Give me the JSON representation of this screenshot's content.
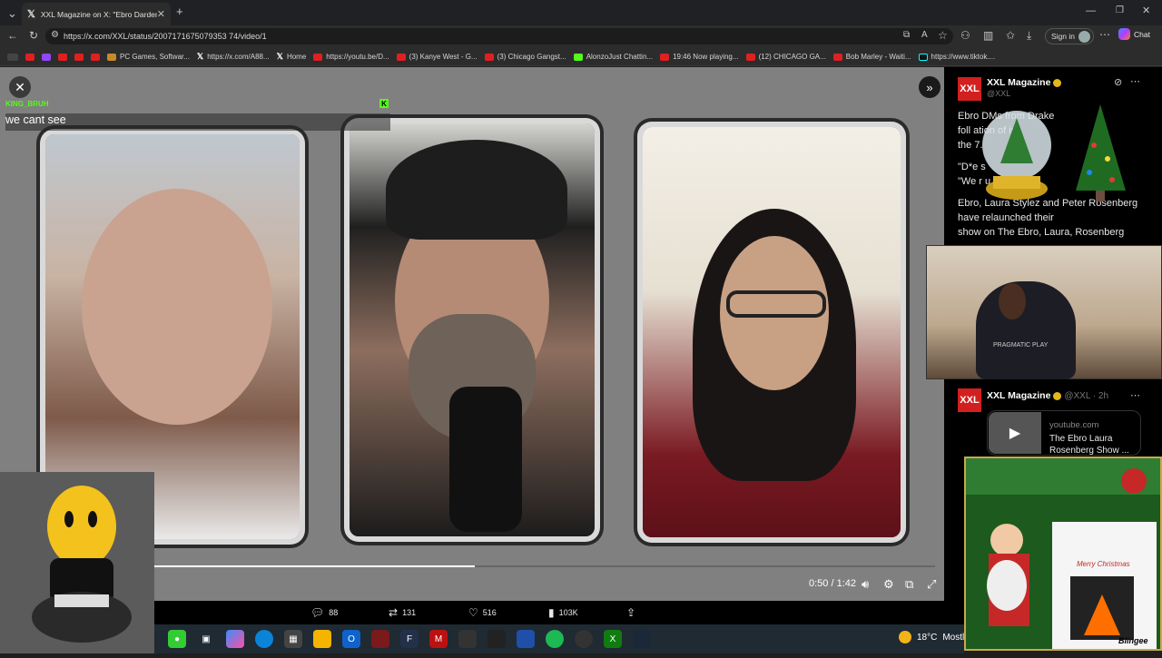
{
  "browser": {
    "tab_title": "XXL Magazine on X: \"Ebro Darden",
    "url": "https://x.com/XXL/status/2007171675079353 74/video/1",
    "sign_in": "Sign in",
    "chat": "Chat"
  },
  "bookmarks": [
    {
      "label": "PC Games, Softwar...",
      "icon": "pc-icon"
    },
    {
      "label": "https://x.com/A88...",
      "icon": "x-icon"
    },
    {
      "label": "Home",
      "icon": "x-icon"
    },
    {
      "label": "https://youtu.be/D...",
      "icon": "youtube-icon"
    },
    {
      "label": "(3) Kanye West - G...",
      "icon": "youtube-icon"
    },
    {
      "label": "(3) Chicago Gangst...",
      "icon": "youtube-icon"
    },
    {
      "label": "AlonzoJust Chattin...",
      "icon": "kick-icon"
    },
    {
      "label": "19:46 Now playing...",
      "icon": "youtube-icon"
    },
    {
      "label": "(12) CHICAGO GA...",
      "icon": "youtube-icon"
    },
    {
      "label": "Bob Marley - Waiti...",
      "icon": "youtube-icon"
    },
    {
      "label": "https://www.tiktok....",
      "icon": "tiktok-icon"
    }
  ],
  "chat_overlay": {
    "username": "KING_BRUH",
    "message": "we cant see"
  },
  "video": {
    "time": "0:50 / 1:42",
    "progress": 0.41
  },
  "actions": {
    "replies": "88",
    "reposts": "131",
    "likes": "516",
    "views": "103K"
  },
  "sidebar": {
    "account_name": "XXL Magazine",
    "handle": "@XXL",
    "logo": "XXL",
    "tweet_line1": "Ebro                DMs from Drake",
    "tweet_line2": "foll               ation of  in",
    "tweet_line3": "the                 7.",
    "tweet_line4": "\"D*e s",
    "tweet_line5": "\"We                     r u",
    "tweet_line6": "Ebro, Laura Stylez and Peter Rosenberg have relaunched their",
    "tweet_line7": "show on The Ebro, Laura, Rosenberg",
    "tweet2_name": "XXL Magazine",
    "tweet2_handle": "@XXL · 2h",
    "card_domain": "youtube.com",
    "card_title": "The Ebro Laura Rosenberg Show ..."
  },
  "webcam": {
    "shirt_text": "PRAGMATIC PLAY"
  },
  "christmas_card": {
    "text": "Merry Christmas",
    "brand": "Blingee"
  },
  "taskbar": {
    "temperature": "18°C",
    "weather": "Mostl"
  },
  "colors": {
    "kick_green": "#53fc18",
    "xxl_red": "#d21f1f",
    "verified_gold": "#e2b719"
  }
}
